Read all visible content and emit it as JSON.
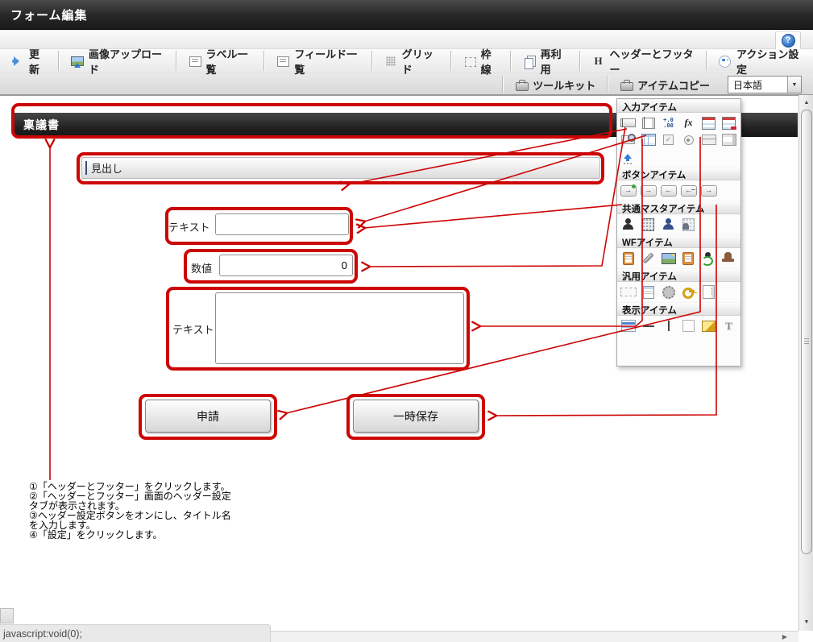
{
  "window": {
    "title": "フォーム編集"
  },
  "colors": {
    "annotation_red": "#cc0505",
    "accent_blue": "#3b7fd4",
    "titlebar_dark": "#262626"
  },
  "help": {
    "glyph": "?"
  },
  "toolbar": {
    "row1": [
      {
        "label": "更新",
        "icon": "refresh-icon"
      },
      {
        "label": "画像アップロード",
        "icon": "upload-image-icon"
      },
      {
        "label": "ラベル一覧",
        "icon": "list-icon"
      },
      {
        "label": "フィールド一覧",
        "icon": "list-icon"
      },
      {
        "label": "グリッド",
        "icon": "grid-icon"
      },
      {
        "label": "枠線",
        "icon": "border-icon"
      },
      {
        "label": "再利用",
        "icon": "reuse-icon"
      },
      {
        "label": "ヘッダーとフッター",
        "icon": "h-icon"
      },
      {
        "label": "アクション設定",
        "icon": "action-icon"
      }
    ],
    "row2": [
      {
        "label": "ツールキット",
        "icon": "toolkit-icon"
      },
      {
        "label": "アイテムコピー",
        "icon": "item-copy-icon"
      }
    ],
    "language_select": {
      "value": "日本語"
    }
  },
  "form": {
    "header_title": "稟議書",
    "heading_label": "見出し",
    "text_label": "テキスト",
    "text_value": "",
    "number_label": "数値",
    "number_value": "0",
    "textarea_label": "テキスト",
    "textarea_value": "",
    "submit_button": "申請",
    "save_button": "一時保存"
  },
  "palette": {
    "sections": [
      {
        "title": "入力アイテム",
        "icons": [
          "text-input-icon",
          "textarea-item-icon",
          "number-item-icon",
          "function-item-icon",
          "date-item-icon",
          "date-period-item-icon",
          "search-input-icon",
          "table-item-icon",
          "checkbox-item-icon",
          "radio-item-icon",
          "list-rows-icon",
          "select-list-icon",
          "file-upload-icon"
        ]
      },
      {
        "title": "ボタンアイテム",
        "icons": [
          "button-approve-icon",
          "button-forward-icon",
          "button-back-icon",
          "button-pullback-icon",
          "button-send-icon"
        ]
      },
      {
        "title": "共通マスタアイテム",
        "icons": [
          "user-master-icon",
          "org-master-icon",
          "user-select-icon",
          "org-select-icon"
        ]
      },
      {
        "title": "WFアイテム",
        "icons": [
          "document-info-icon",
          "attachment-icon",
          "image-wf-icon",
          "history-icon",
          "route-change-icon",
          "stamp-icon"
        ]
      },
      {
        "title": "汎用アイテム",
        "icons": [
          "spacer-icon",
          "rich-text-icon",
          "gear-item-icon",
          "auth-key-icon",
          "panel-item-icon"
        ]
      },
      {
        "title": "表示アイテム",
        "icons": [
          "heading-item-icon",
          "hline-icon",
          "vline-icon",
          "box-item-icon",
          "image-display-icon",
          "text-display-icon"
        ]
      }
    ]
  },
  "steps": {
    "lines": [
      "①「ヘッダーとフッター」をクリックします。",
      "②「ヘッダーとフッター」画面のヘッダー設定",
      "タブが表示されます。",
      "③ヘッダー設定ボタンをオンにし、タイトル名",
      "を入力します。",
      "④「設定」をクリックします。"
    ]
  },
  "statusbar": {
    "text": "javascript:void(0);"
  }
}
